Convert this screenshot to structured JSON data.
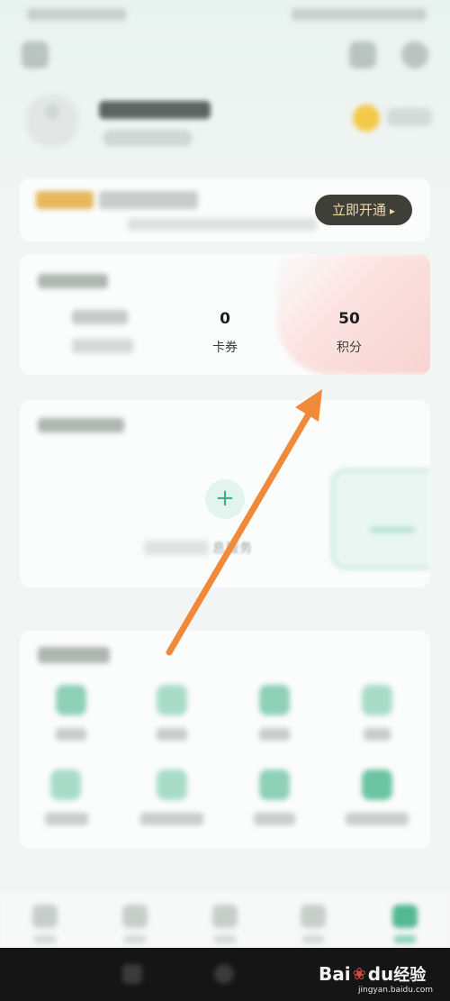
{
  "status_bar": {
    "left": "",
    "right": ""
  },
  "vip_banner": {
    "open_button_label": "立即开通",
    "open_button_chevron": "▸"
  },
  "assets": {
    "stats": [
      {
        "value": "0",
        "label": "卡券"
      },
      {
        "value": "50",
        "label": "积分"
      }
    ]
  },
  "vehicle": {
    "add_glyph": "+",
    "hint_visible": "息服务"
  },
  "annotation": {
    "arrow_color": "#F0893A"
  },
  "watermark": {
    "logo": "Bai",
    "paw": "❀",
    "du": "du",
    "text": "经验",
    "url": "jingyan.baidu.com"
  },
  "colors": {
    "accent_green": "#3FAE8A",
    "vip_gold": "#E7B65D",
    "button_dark": "#3F3F3A"
  }
}
